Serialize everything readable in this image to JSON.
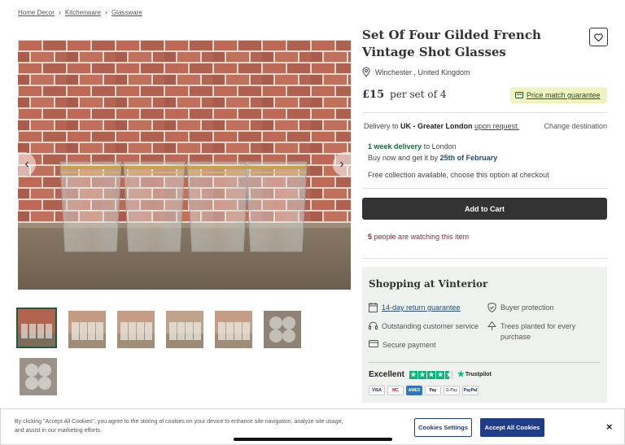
{
  "breadcrumb": [
    "Home Decor",
    "Kitchenware",
    "Glassware"
  ],
  "product": {
    "title": "Set Of Four Gilded French Vintage Shot Glasses",
    "location": "Winchester , United Kingdom",
    "price": "£15",
    "price_unit": "per set of 4",
    "price_match": "Price match guarantee"
  },
  "delivery": {
    "prefix": "Delivery to",
    "region": "UK - Greater London",
    "request": "upon request.",
    "change": "Change destination",
    "speed": "1 week delivery",
    "speed_suffix": "to London",
    "buy_now": "Buy now and get it by",
    "date": "25th of February",
    "collection": "Free collection available, choose this option at checkout"
  },
  "add_to_cart": "Add to Cart",
  "watching": {
    "count": "5",
    "text": "people are watching this item"
  },
  "vinterior": {
    "title": "Shopping at Vinterior",
    "return": "14-day return guarantee",
    "buyer": "Buyer protection",
    "service": "Outstanding customer service",
    "trees": "Trees planted for every purchase",
    "payment": "Secure payment",
    "rating": "Excellent",
    "trustpilot": "Trustpilot",
    "cards": [
      "VISA",
      "MC",
      "AMEX",
      "Pay",
      "G Pay",
      "PayPal"
    ]
  },
  "cookie": {
    "text": "By clicking \"Accept All Cookies\", you agree to the storing of cookies on your device to enhance site navigation, analyze site usage, and assist in our marketing efforts.",
    "settings": "Cookies Settings",
    "accept": "Accept All Cookies",
    "close": "×"
  },
  "colors": {
    "brand_green": "#1e5b3b",
    "cta": "#333333",
    "cookie_blue": "#1f3c87",
    "pmg_bg": "#eef3c0",
    "trustpilot": "#00b67a"
  },
  "icons": [
    "chevron-right-icon",
    "heart-icon",
    "location-pin-icon",
    "price-tag-icon",
    "calendar-icon",
    "shield-icon",
    "headset-icon",
    "tree-icon",
    "card-icon",
    "star-icon",
    "close-icon"
  ]
}
